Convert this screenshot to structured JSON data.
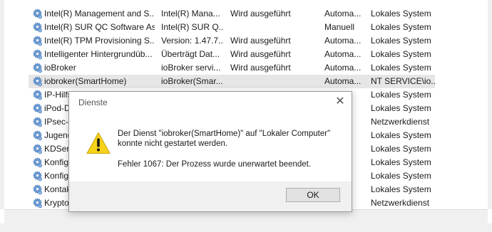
{
  "dialog": {
    "title": "Dienste",
    "close_glyph": "✕",
    "message_line1": "Der Dienst \"iobroker(SmartHome)\" auf \"Lokaler Computer\"",
    "message_line2": "konnte nicht gestartet werden.",
    "error_line": "Fehler 1067: Der Prozess wurde unerwartet beendet.",
    "ok_label": "OK",
    "icon": "warning-icon"
  },
  "services": [
    {
      "name": "Intel(R) Management and S...",
      "description": "Intel(R) Mana...",
      "status": "Wird ausgeführt",
      "startup": "Automa...",
      "logon": "Lokales System"
    },
    {
      "name": "Intel(R) SUR QC Software As...",
      "description": "Intel(R) SUR Q...",
      "status": "",
      "startup": "Manuell",
      "logon": "Lokales System"
    },
    {
      "name": "Intel(R) TPM Provisioning S...",
      "description": "Version: 1.47.7...",
      "status": "Wird ausgeführt",
      "startup": "Automa...",
      "logon": "Lokales System"
    },
    {
      "name": "Intelligenter Hintergrundüb...",
      "description": "Überträgt Dat...",
      "status": "Wird ausgeführt",
      "startup": "Automa...",
      "logon": "Lokales System"
    },
    {
      "name": "ioBroker",
      "description": "ioBroker servi...",
      "status": "Wird ausgeführt",
      "startup": "Automa...",
      "logon": "Lokales System"
    },
    {
      "name": "iobroker(SmartHome)",
      "description": "ioBroker(Smar...",
      "status": "",
      "startup": "Automa...",
      "logon": "NT SERVICE\\io...",
      "selected": true
    },
    {
      "name": "IP-Hilfsd",
      "description": "",
      "status": "",
      "startup": "",
      "logon": "Lokales System"
    },
    {
      "name": "iPod-Di",
      "description": "",
      "status": "",
      "startup": "",
      "logon": "Lokales System"
    },
    {
      "name": "IPsec-R",
      "description": "",
      "status": "",
      "startup": "",
      "logon": "Netzwerkdienst"
    },
    {
      "name": "Jugend",
      "description": "",
      "status": "",
      "startup": "",
      "logon": "Lokales System"
    },
    {
      "name": "KDServi",
      "description": "",
      "status": "",
      "startup": "",
      "logon": "Lokales System"
    },
    {
      "name": "Konfigu",
      "description": "",
      "status": "",
      "startup": "",
      "logon": "Lokales System"
    },
    {
      "name": "Konfigu",
      "description": "",
      "status": "",
      "startup": "",
      "logon": "Lokales System"
    },
    {
      "name": "Kontakt",
      "description": "",
      "status": "",
      "startup": "",
      "logon": "Lokales System"
    },
    {
      "name": "Kryptog",
      "description": "",
      "status": "",
      "startup": "",
      "logon": "Netzwerkdienst"
    }
  ],
  "icons": {
    "service": "gear-icon"
  }
}
